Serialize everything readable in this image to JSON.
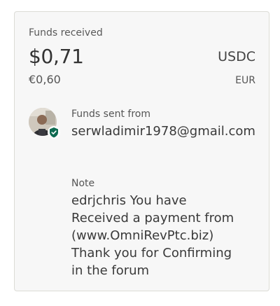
{
  "funds": {
    "label": "Funds received",
    "amount": "$0,71",
    "currency": "USDC",
    "secondary_amount": "€0,60",
    "secondary_currency": "EUR"
  },
  "sender": {
    "label": "Funds sent from",
    "email": "serwladimir1978@gmail.com"
  },
  "note": {
    "label": "Note",
    "text": "edrjchris You have\nReceived a payment from\n(www.OmniRevPtc.biz)\nThank you for Confirming\nin the forum"
  },
  "colors": {
    "card_background": "#f7f7f7",
    "card_border": "#dcdcd6",
    "verified_badge": "#0e6b52"
  },
  "icons": {
    "avatar": "avatar",
    "badge": "verified-shield-icon"
  }
}
